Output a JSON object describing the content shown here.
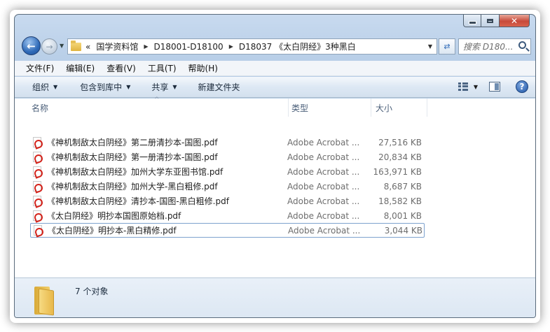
{
  "window": {
    "caption_buttons": {
      "minimize": "",
      "maximize": "",
      "close": "✕"
    }
  },
  "address": {
    "lead": "«",
    "breadcrumbs": [
      "国学资料馆",
      "D18001-D18100",
      "D18037 《太白阴经》3种黑白"
    ]
  },
  "search": {
    "placeholder": "搜索 D180..."
  },
  "menu": [
    "文件(F)",
    "编辑(E)",
    "查看(V)",
    "工具(T)",
    "帮助(H)"
  ],
  "commands": {
    "organize": "组织",
    "include_in_library": "包含到库中",
    "share": "共享",
    "new_folder": "新建文件夹"
  },
  "columns": {
    "name": "名称",
    "type": "类型",
    "size": "大小"
  },
  "files": [
    {
      "name": "《神机制敌太白阴经》第二册清抄本-国图.pdf",
      "type": "Adobe Acrobat ...",
      "size": "27,516 KB"
    },
    {
      "name": "《神机制敌太白阴经》第一册清抄本-国图.pdf",
      "type": "Adobe Acrobat ...",
      "size": "20,834 KB"
    },
    {
      "name": "《神机制敌太白阴经》加州大学东亚图书馆.pdf",
      "type": "Adobe Acrobat ...",
      "size": "163,971 KB"
    },
    {
      "name": "《神机制敌太白阴经》加州大学-黑白粗修.pdf",
      "type": "Adobe Acrobat ...",
      "size": "8,687 KB"
    },
    {
      "name": "《神机制敌太白阴经》清抄本-国图-黑白粗修.pdf",
      "type": "Adobe Acrobat ...",
      "size": "18,582 KB"
    },
    {
      "name": "《太白阴经》明抄本国图原始档.pdf",
      "type": "Adobe Acrobat ...",
      "size": "8,001 KB"
    },
    {
      "name": "《太白阴经》明抄本-黑白精修.pdf",
      "type": "Adobe Acrobat ...",
      "size": "3,044 KB"
    }
  ],
  "details": {
    "count": "7 个对象"
  },
  "colors": {
    "title_bar": "#bcd2ea",
    "accent": "#2f6ab8",
    "selection_border": "#7da2ce",
    "close": "#c84a3a",
    "pdf_red": "#d4241c"
  }
}
